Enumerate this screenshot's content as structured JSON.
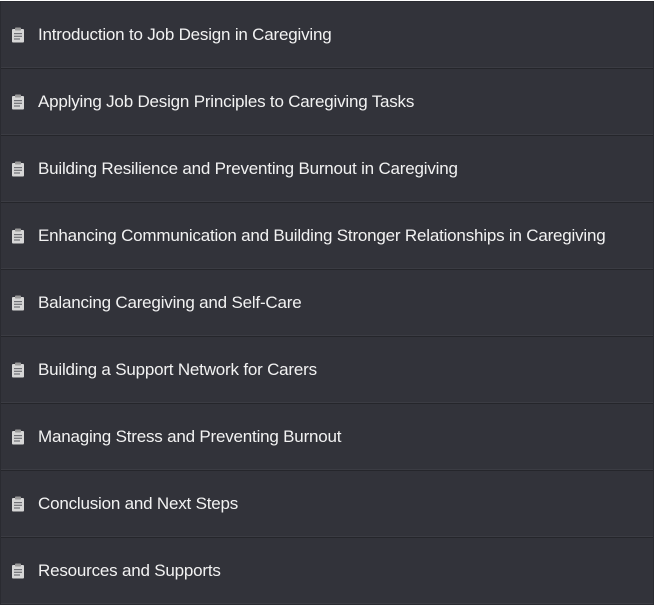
{
  "lessons": [
    {
      "title": "Introduction to Job Design in Caregiving",
      "icon": "clipboard-icon"
    },
    {
      "title": "Applying Job Design Principles to Caregiving Tasks",
      "icon": "clipboard-icon"
    },
    {
      "title": "Building Resilience and Preventing Burnout in Caregiving",
      "icon": "clipboard-icon"
    },
    {
      "title": "Enhancing Communication and Building Stronger Relationships in Caregiving",
      "icon": "clipboard-icon"
    },
    {
      "title": "Balancing Caregiving and Self-Care",
      "icon": "clipboard-icon"
    },
    {
      "title": "Building a Support Network for Carers",
      "icon": "clipboard-icon"
    },
    {
      "title": "Managing Stress and Preventing Burnout",
      "icon": "clipboard-icon"
    },
    {
      "title": "Conclusion and Next Steps",
      "icon": "clipboard-icon"
    },
    {
      "title": "Resources and Supports",
      "icon": "clipboard-icon"
    }
  ],
  "colors": {
    "background": "#32333a",
    "text": "#f2f2f2",
    "icon": "#d7d7d7"
  }
}
